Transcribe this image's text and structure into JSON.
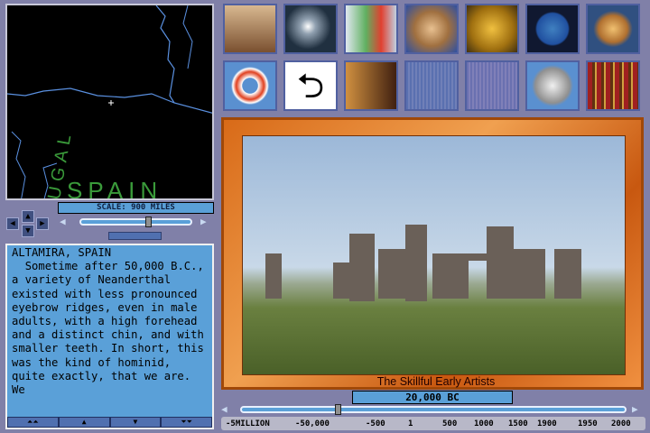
{
  "map": {
    "labels": [
      "UGAL",
      "SPAIN"
    ],
    "scale": "SCALE: 900 MILES",
    "zoom_level": 0.62
  },
  "text": {
    "title": "ALTAMIRA, SPAIN",
    "body": "  Sometime after 50,000 B.C., a variety of Neanderthal existed with less pronounced eyebrow ridges, even in male adults, with a high forehead and a distinct chin, and with smaller teeth. In short, this was the kind of hominid, quite exactly, that we are. We"
  },
  "scroll_buttons": [
    "⏶⏶",
    "▲",
    "▼",
    "⏷⏷"
  ],
  "tools": [
    "abacus",
    "prism",
    "lab-flasks",
    "fetus",
    "gears",
    "globe",
    "saturn",
    "life-ring",
    "u-turn",
    "chess",
    "dim-tile-1",
    "dim-tile-2",
    "printer",
    "books"
  ],
  "picture": {
    "caption": "The Skillful Early Artists"
  },
  "timeline": {
    "date": "20,000 BC",
    "position": 0.245,
    "labels": [
      "-5MILLION",
      "-50,000",
      "-500",
      "1",
      "500",
      "1000",
      "1500",
      "1900",
      "1950",
      "2000"
    ]
  }
}
